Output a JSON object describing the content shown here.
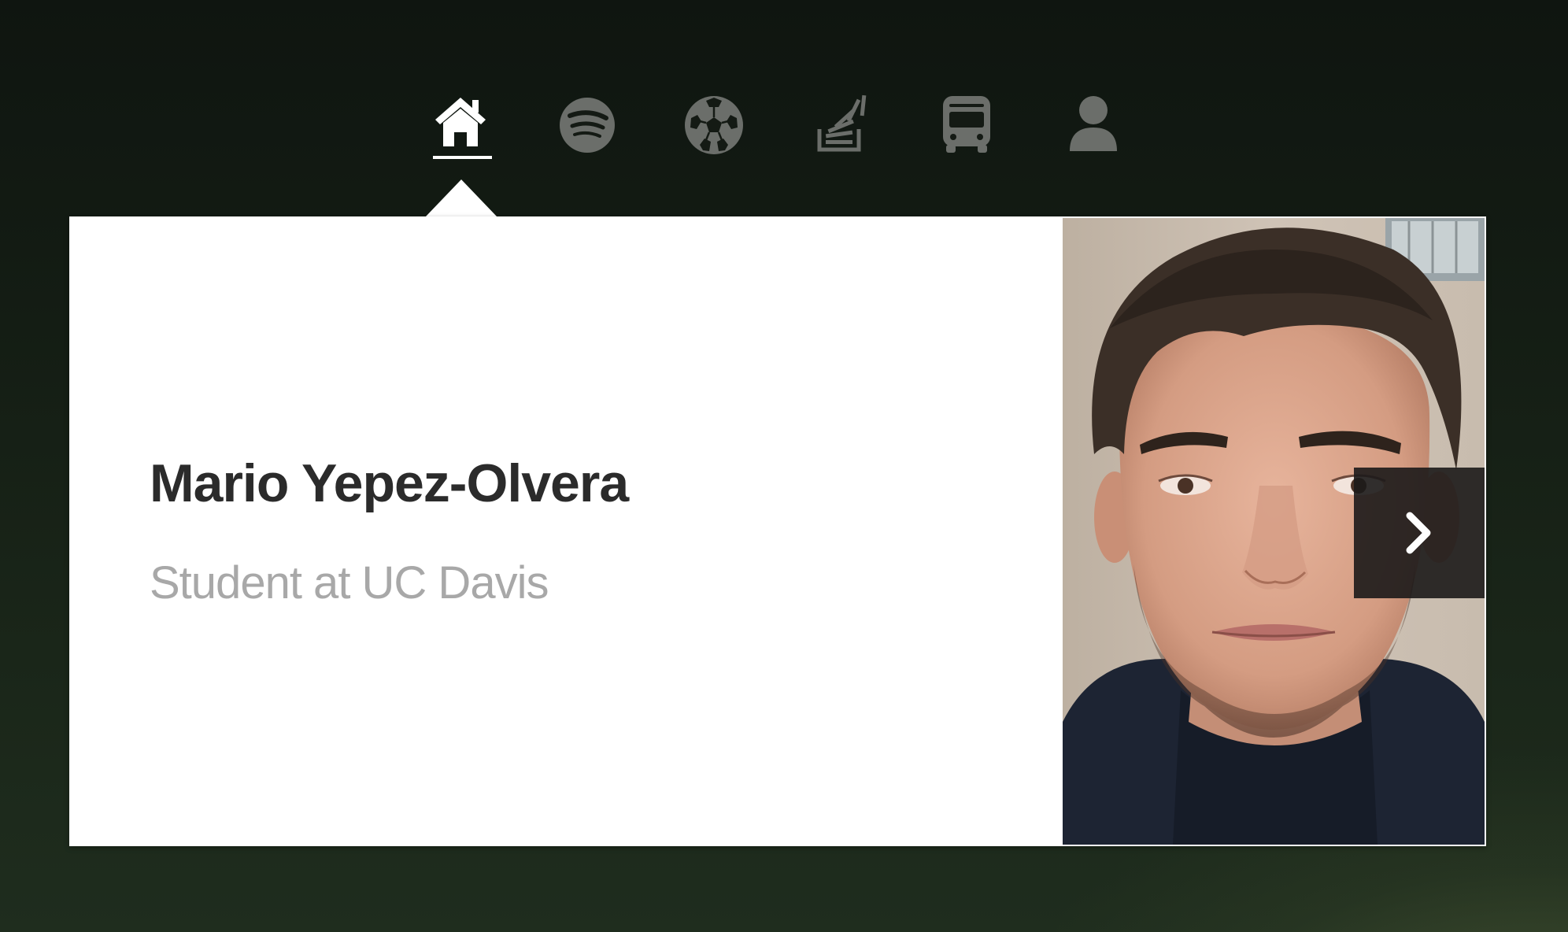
{
  "nav": {
    "items": [
      {
        "icon": "home-icon",
        "active": true
      },
      {
        "icon": "spotify-icon",
        "active": false
      },
      {
        "icon": "soccer-ball-icon",
        "active": false
      },
      {
        "icon": "stack-overflow-icon",
        "active": false
      },
      {
        "icon": "bus-icon",
        "active": false
      },
      {
        "icon": "user-icon",
        "active": false
      }
    ],
    "active_color": "#ffffff",
    "inactive_color": "#6b6e6a"
  },
  "profile": {
    "name": "Mario Yepez-Olvera",
    "subtitle": "Student at UC Davis"
  },
  "photo": {
    "alt": "Mario Yepez-Olvera"
  },
  "slider": {
    "next_icon": "chevron-right-icon"
  }
}
